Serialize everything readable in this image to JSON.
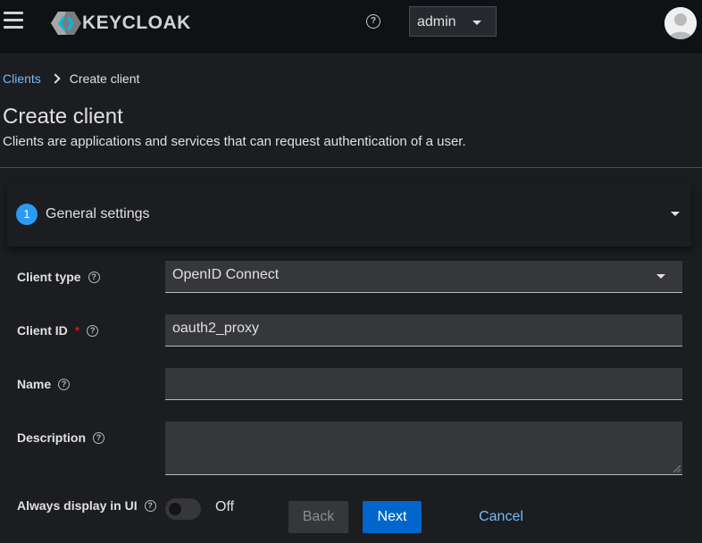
{
  "header": {
    "logo_text": "KEYCLOAK",
    "help_icon": "help-circle-icon",
    "user_menu_label": "admin"
  },
  "breadcrumb": {
    "parent": "Clients",
    "current": "Create client"
  },
  "page": {
    "title": "Create client",
    "description": "Clients are applications and services that can request authentication of a user."
  },
  "wizard": {
    "step_number": "1",
    "step_label": "General settings"
  },
  "form": {
    "client_type": {
      "label": "Client type",
      "value": "OpenID Connect"
    },
    "client_id": {
      "label": "Client ID",
      "required_mark": "*",
      "value": "oauth2_proxy"
    },
    "name": {
      "label": "Name",
      "value": ""
    },
    "description": {
      "label": "Description",
      "value": ""
    },
    "always_display": {
      "label": "Always display in UI",
      "state": "Off"
    }
  },
  "actions": {
    "back": "Back",
    "next": "Next",
    "cancel": "Cancel"
  },
  "colors": {
    "masthead": "#0f1214",
    "background": "#1b1d21",
    "link": "#73bcf7",
    "primary": "#0066cc",
    "step_badge": "#2b9af3",
    "required": "#c9190b"
  }
}
